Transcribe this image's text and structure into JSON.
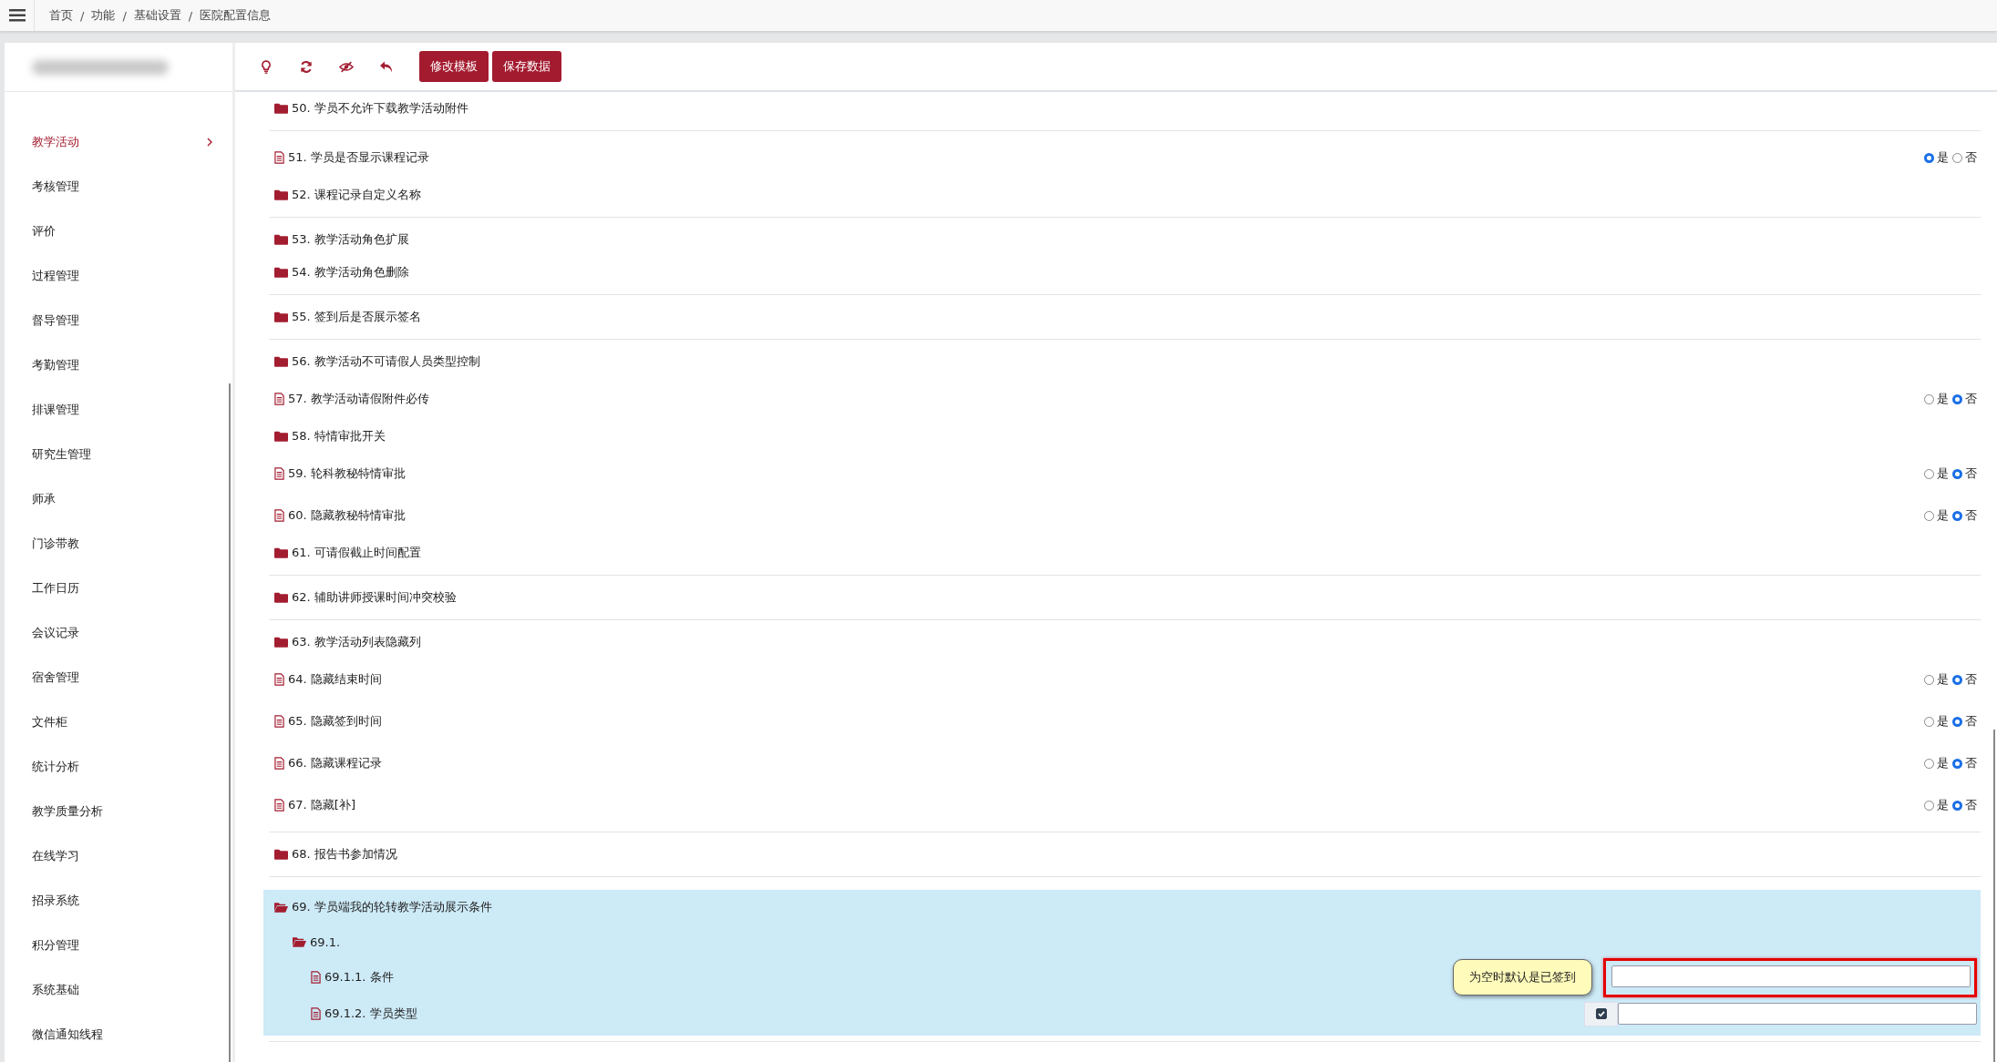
{
  "breadcrumb": {
    "separator": "/",
    "items": [
      "首页",
      "功能",
      "基础设置",
      "医院配置信息"
    ]
  },
  "sidebar": {
    "items": [
      {
        "label": "教学活动",
        "selected": true,
        "has_submenu": true
      },
      {
        "label": "考核管理",
        "selected": false,
        "has_submenu": false
      },
      {
        "label": "评价",
        "selected": false,
        "has_submenu": false
      },
      {
        "label": "过程管理",
        "selected": false,
        "has_submenu": false
      },
      {
        "label": "督导管理",
        "selected": false,
        "has_submenu": false
      },
      {
        "label": "考勤管理",
        "selected": false,
        "has_submenu": false
      },
      {
        "label": "排课管理",
        "selected": false,
        "has_submenu": false
      },
      {
        "label": "研究生管理",
        "selected": false,
        "has_submenu": false
      },
      {
        "label": "师承",
        "selected": false,
        "has_submenu": false
      },
      {
        "label": "门诊带教",
        "selected": false,
        "has_submenu": false
      },
      {
        "label": "工作日历",
        "selected": false,
        "has_submenu": false
      },
      {
        "label": "会议记录",
        "selected": false,
        "has_submenu": false
      },
      {
        "label": "宿舍管理",
        "selected": false,
        "has_submenu": false
      },
      {
        "label": "文件柜",
        "selected": false,
        "has_submenu": false
      },
      {
        "label": "统计分析",
        "selected": false,
        "has_submenu": false
      },
      {
        "label": "教学质量分析",
        "selected": false,
        "has_submenu": false
      },
      {
        "label": "在线学习",
        "selected": false,
        "has_submenu": false
      },
      {
        "label": "招录系统",
        "selected": false,
        "has_submenu": false
      },
      {
        "label": "积分管理",
        "selected": false,
        "has_submenu": false
      },
      {
        "label": "系统基础",
        "selected": false,
        "has_submenu": false
      },
      {
        "label": "微信通知线程",
        "selected": false,
        "has_submenu": false
      }
    ]
  },
  "toolbar": {
    "buttons": [
      "修改模板",
      "保存数据"
    ]
  },
  "settings": [
    {
      "items": [
        {
          "kind": "folder",
          "label": "50. 学员不允许下载教学活动附件",
          "expanded": false,
          "selected": false
        }
      ]
    },
    {
      "items": [
        {
          "kind": "file",
          "label": "51. 学员是否显示课程记录",
          "selected": false,
          "choice": [
            {
              "label": "是",
              "selected": true
            },
            {
              "label": "否",
              "selected": false
            }
          ]
        },
        {
          "kind": "folder",
          "label": "52. 课程记录自定义名称",
          "expanded": false,
          "selected": false
        }
      ]
    },
    {
      "items": [
        {
          "kind": "folder",
          "label": "53. 教学活动角色扩展",
          "expanded": false,
          "selected": false
        },
        {
          "kind": "folder",
          "label": "54. 教学活动角色删除",
          "expanded": false,
          "selected": false
        }
      ]
    },
    {
      "items": [
        {
          "kind": "folder",
          "label": "55. 签到后是否展示签名",
          "expanded": false,
          "selected": false
        }
      ]
    },
    {
      "items": [
        {
          "kind": "folder",
          "label": "56. 教学活动不可请假人员类型控制",
          "expanded": false,
          "selected": false
        },
        {
          "kind": "file",
          "label": "57. 教学活动请假附件必传",
          "selected": false,
          "choice": [
            {
              "label": "是",
              "selected": false
            },
            {
              "label": "否",
              "selected": true
            }
          ]
        },
        {
          "kind": "folder",
          "label": "58. 特情审批开关",
          "expanded": false,
          "selected": false
        },
        {
          "kind": "file",
          "label": "59. 轮科教秘特情审批",
          "selected": false,
          "choice": [
            {
              "label": "是",
              "selected": false
            },
            {
              "label": "否",
              "selected": true
            }
          ]
        },
        {
          "kind": "file",
          "label": "60. 隐藏教秘特情审批",
          "selected": false,
          "choice": [
            {
              "label": "是",
              "selected": false
            },
            {
              "label": "否",
              "selected": true
            }
          ]
        },
        {
          "kind": "folder",
          "label": "61. 可请假截止时间配置",
          "expanded": false,
          "selected": false
        }
      ]
    },
    {
      "items": [
        {
          "kind": "folder",
          "label": "62. 辅助讲师授课时间冲突校验",
          "expanded": false,
          "selected": false
        }
      ]
    },
    {
      "items": [
        {
          "kind": "folder",
          "label": "63. 教学活动列表隐藏列",
          "expanded": false,
          "selected": false
        },
        {
          "kind": "file",
          "label": "64. 隐藏结束时间",
          "selected": false,
          "choice": [
            {
              "label": "是",
              "selected": false
            },
            {
              "label": "否",
              "selected": true
            }
          ]
        },
        {
          "kind": "file",
          "label": "65. 隐藏签到时间",
          "selected": false,
          "choice": [
            {
              "label": "是",
              "selected": false
            },
            {
              "label": "否",
              "selected": true
            }
          ]
        },
        {
          "kind": "file",
          "label": "66. 隐藏课程记录",
          "selected": false,
          "choice": [
            {
              "label": "是",
              "selected": false
            },
            {
              "label": "否",
              "selected": true
            }
          ]
        },
        {
          "kind": "file",
          "label": "67. 隐藏[补]",
          "selected": false,
          "choice": [
            {
              "label": "是",
              "selected": false
            },
            {
              "label": "否",
              "selected": true
            }
          ]
        }
      ]
    },
    {
      "items": [
        {
          "kind": "folder",
          "label": "68. 报告书参加情况",
          "expanded": false,
          "selected": false
        }
      ]
    },
    {
      "items": [
        {
          "kind": "folder",
          "label": "69. 学员端我的轮转教学活动展示条件",
          "expanded": true,
          "selected": true,
          "children": [
            {
              "kind": "folder",
              "label": "69.1.",
              "expanded": true,
              "children": [
                {
                  "kind": "file",
                  "label": "69.1.1. 条件",
                  "control": {
                    "kind": "text",
                    "highlighted": true,
                    "tooltip": "为空时默认是已签到"
                  }
                },
                {
                  "kind": "file",
                  "label": "69.1.2. 学员类型",
                  "control": {
                    "kind": "checkbox_text",
                    "checked": true,
                    "highlighted": false
                  }
                }
              ]
            }
          ]
        }
      ]
    }
  ]
}
